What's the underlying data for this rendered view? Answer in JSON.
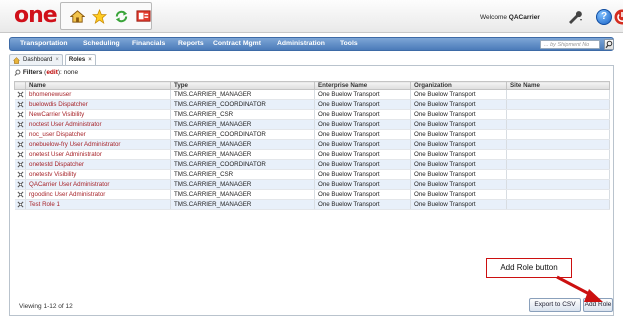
{
  "header": {
    "logo_text": "one",
    "welcome_prefix": "Welcome",
    "username": "QACarrier",
    "icons": [
      "home-icon",
      "favorites-star-icon",
      "refresh-icon",
      "presentation-icon",
      "settings-wrench-icon",
      "help-icon",
      "power-icon"
    ]
  },
  "nav": {
    "items": [
      "Transportation",
      "Scheduling",
      "Financials",
      "Reports",
      "Contract Mgmt",
      "Administration",
      "Tools"
    ],
    "search_placeholder": "... by Shipment No"
  },
  "tabs": [
    {
      "label": "Dashboard",
      "close": "×"
    },
    {
      "label": "Roles",
      "close": "×"
    }
  ],
  "filters": {
    "label": "Filters",
    "edit": "edit",
    "value": "none"
  },
  "table": {
    "columns": [
      "Name",
      "Type",
      "Enterprise Name",
      "Organization",
      "Site Name"
    ],
    "rows": [
      [
        "bhomenewuser",
        "TMS.CARRIER_MANAGER",
        "One Buelow Transport",
        "One Buelow Transport",
        ""
      ],
      [
        "buelowdis Dispatcher",
        "TMS.CARRIER_COORDINATOR",
        "One Buelow Transport",
        "One Buelow Transport",
        ""
      ],
      [
        "NewCarrier Visibility",
        "TMS.CARRIER_CSR",
        "One Buelow Transport",
        "One Buelow Transport",
        ""
      ],
      [
        "noctest User Administrator",
        "TMS.CARRIER_MANAGER",
        "One Buelow Transport",
        "One Buelow Transport",
        ""
      ],
      [
        "noc_user Dispatcher",
        "TMS.CARRIER_COORDINATOR",
        "One Buelow Transport",
        "One Buelow Transport",
        ""
      ],
      [
        "onebuelow-fry User Administrator",
        "TMS.CARRIER_MANAGER",
        "One Buelow Transport",
        "One Buelow Transport",
        ""
      ],
      [
        "onetest User Administrator",
        "TMS.CARRIER_MANAGER",
        "One Buelow Transport",
        "One Buelow Transport",
        ""
      ],
      [
        "onetestd Dispatcher",
        "TMS.CARRIER_COORDINATOR",
        "One Buelow Transport",
        "One Buelow Transport",
        ""
      ],
      [
        "onetestv Visibility",
        "TMS.CARRIER_CSR",
        "One Buelow Transport",
        "One Buelow Transport",
        ""
      ],
      [
        "QACarrier User Administrator",
        "TMS.CARRIER_MANAGER",
        "One Buelow Transport",
        "One Buelow Transport",
        ""
      ],
      [
        "rgoodinc User Administrator",
        "TMS.CARRIER_MANAGER",
        "One Buelow Transport",
        "One Buelow Transport",
        ""
      ],
      [
        "Test Role 1",
        "TMS.CARRIER_MANAGER",
        "One Buelow Transport",
        "One Buelow Transport",
        ""
      ]
    ]
  },
  "footer": {
    "viewing": "Viewing 1-12 of 12",
    "export_label": "Export to CSV",
    "add_role_label": "Add Role"
  },
  "annotation": {
    "text": "Add Role button",
    "color": "#cc1010"
  },
  "colors": {
    "nav": "#4b7bb9",
    "logo": "#d0101a",
    "name_link": "#a7242a",
    "alt_row": "#e8f0fa"
  }
}
